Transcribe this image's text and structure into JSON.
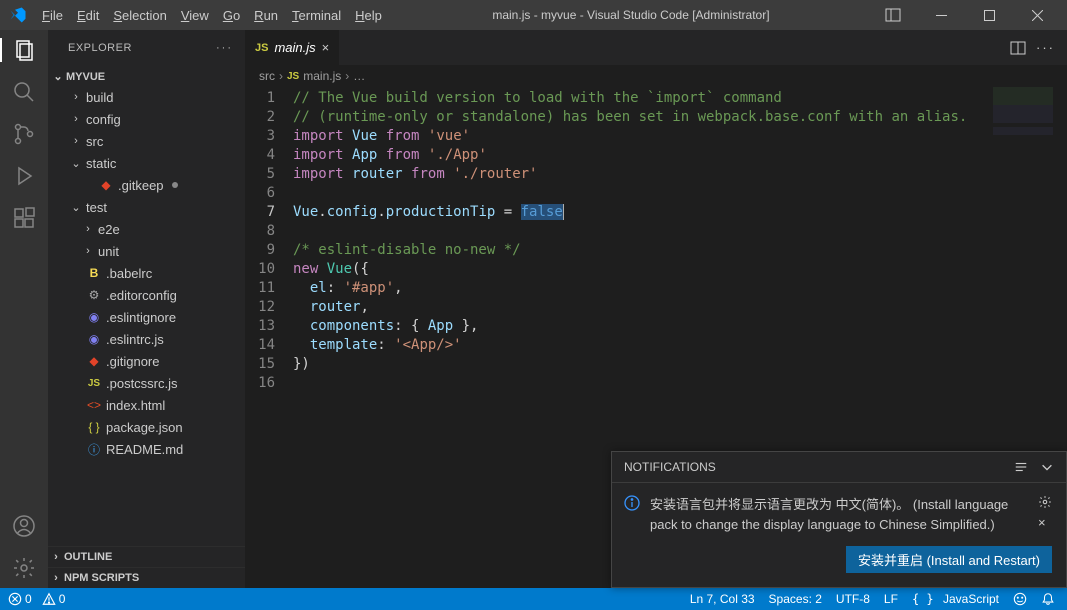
{
  "window": {
    "title": "main.js - myvue - Visual Studio Code [Administrator]"
  },
  "menu": [
    "File",
    "Edit",
    "Selection",
    "View",
    "Go",
    "Run",
    "Terminal",
    "Help"
  ],
  "explorer": {
    "header": "EXPLORER",
    "project": "MYVUE",
    "tree": [
      {
        "depth": 1,
        "chev": "›",
        "name": "build",
        "type": "folder"
      },
      {
        "depth": 1,
        "chev": "›",
        "name": "config",
        "type": "folder"
      },
      {
        "depth": 1,
        "chev": "›",
        "name": "src",
        "type": "folder"
      },
      {
        "depth": 1,
        "chev": "⌄",
        "name": "static",
        "type": "folder"
      },
      {
        "depth": 2,
        "icon": "git",
        "name": ".gitkeep",
        "mod": true
      },
      {
        "depth": 1,
        "chev": "⌄",
        "name": "test",
        "type": "folder"
      },
      {
        "depth": 2,
        "chev": "›",
        "name": "e2e",
        "type": "folder"
      },
      {
        "depth": 2,
        "chev": "›",
        "name": "unit",
        "type": "folder"
      },
      {
        "depth": 1,
        "icon": "babel",
        "name": ".babelrc"
      },
      {
        "depth": 1,
        "icon": "cfg",
        "name": ".editorconfig"
      },
      {
        "depth": 1,
        "icon": "eslint",
        "name": ".eslintignore"
      },
      {
        "depth": 1,
        "icon": "eslint",
        "name": ".eslintrc.js"
      },
      {
        "depth": 1,
        "icon": "git",
        "name": ".gitignore"
      },
      {
        "depth": 1,
        "icon": "js",
        "name": ".postcssrc.js"
      },
      {
        "depth": 1,
        "icon": "html",
        "name": "index.html"
      },
      {
        "depth": 1,
        "icon": "json",
        "name": "package.json"
      },
      {
        "depth": 1,
        "icon": "readme",
        "name": "README.md"
      }
    ],
    "outline": "OUTLINE",
    "npm": "NPM SCRIPTS"
  },
  "tab": {
    "icon": "JS",
    "label": "main.js"
  },
  "breadcrumb": {
    "parts": [
      "src",
      "main.js"
    ],
    "fileIcon": "JS"
  },
  "code": {
    "lines": [
      [
        {
          "c": "comment",
          "t": "// The Vue build version to load with the `import` command"
        }
      ],
      [
        {
          "c": "comment",
          "t": "// (runtime-only or standalone) has been set in webpack.base.conf with an alias."
        }
      ],
      [
        {
          "c": "kw",
          "t": "import"
        },
        {
          "c": "plain",
          "t": " "
        },
        {
          "c": "var",
          "t": "Vue"
        },
        {
          "c": "plain",
          "t": " "
        },
        {
          "c": "kw",
          "t": "from"
        },
        {
          "c": "plain",
          "t": " "
        },
        {
          "c": "str",
          "t": "'vue'"
        }
      ],
      [
        {
          "c": "kw",
          "t": "import"
        },
        {
          "c": "plain",
          "t": " "
        },
        {
          "c": "var",
          "t": "App"
        },
        {
          "c": "plain",
          "t": " "
        },
        {
          "c": "kw",
          "t": "from"
        },
        {
          "c": "plain",
          "t": " "
        },
        {
          "c": "str",
          "t": "'./App'"
        }
      ],
      [
        {
          "c": "kw",
          "t": "import"
        },
        {
          "c": "plain",
          "t": " "
        },
        {
          "c": "var",
          "t": "router"
        },
        {
          "c": "plain",
          "t": " "
        },
        {
          "c": "kw",
          "t": "from"
        },
        {
          "c": "plain",
          "t": " "
        },
        {
          "c": "str",
          "t": "'./router'"
        }
      ],
      [],
      [
        {
          "c": "var",
          "t": "Vue"
        },
        {
          "c": "plain",
          "t": "."
        },
        {
          "c": "var",
          "t": "config"
        },
        {
          "c": "plain",
          "t": "."
        },
        {
          "c": "var",
          "t": "productionTip"
        },
        {
          "c": "plain",
          "t": " = "
        },
        {
          "c": "const",
          "t": "false",
          "sel": true
        }
      ],
      [],
      [
        {
          "c": "comment",
          "t": "/* eslint-disable no-new */"
        }
      ],
      [
        {
          "c": "kw",
          "t": "new"
        },
        {
          "c": "plain",
          "t": " "
        },
        {
          "c": "type",
          "t": "Vue"
        },
        {
          "c": "plain",
          "t": "({"
        }
      ],
      [
        {
          "c": "plain",
          "t": "  "
        },
        {
          "c": "var",
          "t": "el"
        },
        {
          "c": "plain",
          "t": ": "
        },
        {
          "c": "str",
          "t": "'#app'"
        },
        {
          "c": "plain",
          "t": ","
        }
      ],
      [
        {
          "c": "plain",
          "t": "  "
        },
        {
          "c": "var",
          "t": "router"
        },
        {
          "c": "plain",
          "t": ","
        }
      ],
      [
        {
          "c": "plain",
          "t": "  "
        },
        {
          "c": "var",
          "t": "components"
        },
        {
          "c": "plain",
          "t": ": { "
        },
        {
          "c": "var",
          "t": "App"
        },
        {
          "c": "plain",
          "t": " },"
        }
      ],
      [
        {
          "c": "plain",
          "t": "  "
        },
        {
          "c": "var",
          "t": "template"
        },
        {
          "c": "plain",
          "t": ": "
        },
        {
          "c": "str",
          "t": "'<App/>'"
        }
      ],
      [
        {
          "c": "plain",
          "t": "})"
        }
      ],
      []
    ],
    "currentLine": 7
  },
  "notification": {
    "header": "NOTIFICATIONS",
    "text": "安装语言包并将显示语言更改为 中文(简体)。 (Install language pack to change the display language to Chinese Simplified.)",
    "button": "安装并重启 (Install and Restart)"
  },
  "status": {
    "errors": "0",
    "warnings": "0",
    "lncol": "Ln 7, Col 33",
    "spaces": "Spaces: 2",
    "encoding": "UTF-8",
    "eol": "LF",
    "lang": "JavaScript"
  }
}
